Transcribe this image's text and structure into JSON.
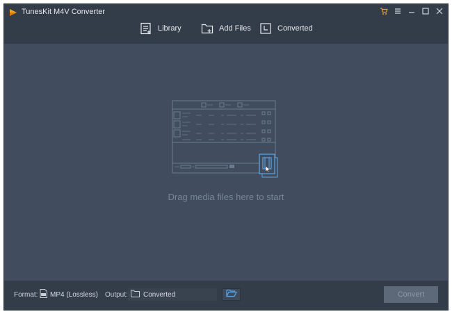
{
  "app": {
    "title": "TunesKit M4V Converter"
  },
  "toolbar": {
    "library": {
      "label": "Library",
      "icon": "library-icon"
    },
    "add_files": {
      "label": "Add Files",
      "icon": "add-folder-icon"
    },
    "converted": {
      "label": "Converted",
      "icon": "converted-icon"
    }
  },
  "window_controls": [
    "cart-icon",
    "menu-icon",
    "minimize-icon",
    "maximize-icon",
    "close-icon"
  ],
  "main": {
    "drag_hint": "Drag media files here to start"
  },
  "bottom": {
    "format_label": "Format:",
    "format_value": "MP4 (Lossless)",
    "output_label": "Output:",
    "output_value": "Converted",
    "convert_label": "Convert"
  },
  "colors": {
    "accent_orange": "#f3a21b",
    "background": "#414d5e",
    "bar": "#333c49",
    "illustration_blue": "#5aa7e6"
  }
}
